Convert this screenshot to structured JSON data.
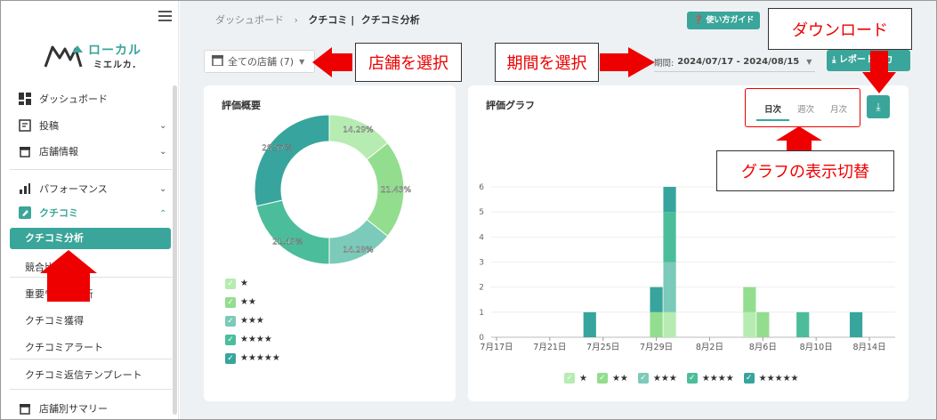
{
  "sidebar": {
    "logo_line1": "ローカル",
    "logo_line2": "ミエルカ.",
    "items": [
      {
        "label": "ダッシュボード"
      },
      {
        "label": "投稿"
      },
      {
        "label": "店舗情報"
      },
      {
        "label": "パフォーマンス"
      },
      {
        "label": "クチコミ"
      }
    ],
    "sub_items": [
      {
        "label": "クチコミ分析"
      },
      {
        "label": "競合比較"
      },
      {
        "label": "重要ワード分析"
      },
      {
        "label": "クチコミ獲得"
      },
      {
        "label": "クチコミアラート"
      },
      {
        "label": "クチコミ返信テンプレート"
      }
    ],
    "bottom_item": "店舗別サマリー"
  },
  "header": {
    "breadcrumb_root": "ダッシュボード",
    "breadcrumb_sep": "›",
    "breadcrumb_parent": "クチコミ |",
    "breadcrumb_current": "クチコミ分析",
    "help_label": "使い方ガイド"
  },
  "filters": {
    "store_value": "全ての店舗 (7)",
    "period_label": "期間:",
    "period_value": "2024/07/17  -  2024/08/15",
    "report_label": "レポート出力"
  },
  "summary_card": {
    "title": "評価概要",
    "legend": [
      "★",
      "★★",
      "★★★",
      "★★★★",
      "★★★★★"
    ]
  },
  "graph_card": {
    "title": "評価グラフ",
    "tabs": [
      "日次",
      "週次",
      "月次"
    ],
    "active_tab": "日次",
    "legend": [
      "★",
      "★★",
      "★★★",
      "★★★★",
      "★★★★★"
    ]
  },
  "colors": {
    "star1": "#b6ecb1",
    "star2": "#93dd8f",
    "star3": "#7ccab9",
    "star4": "#4cbd9a",
    "star5": "#37a59d",
    "accent": "#3aa59a",
    "annotation": "#e00000"
  },
  "annotations": {
    "store": "店舗を選択",
    "period": "期間を選択",
    "download": "ダウンロード",
    "toggle": "グラフの表示切替"
  },
  "chart_data": [
    {
      "type": "pie",
      "title": "評価概要",
      "categories": [
        "★",
        "★★",
        "★★★",
        "★★★★",
        "★★★★★"
      ],
      "values": [
        14.29,
        21.43,
        14.28,
        21.43,
        28.57
      ],
      "labels": [
        "14.29%",
        "21.43%",
        "14.28%",
        "21.43%",
        "28.57%"
      ]
    },
    {
      "type": "bar",
      "title": "評価グラフ",
      "stacked": true,
      "x_tick_labels": [
        "7月17日",
        "7月21日",
        "7月25日",
        "7月29日",
        "8月2日",
        "8月6日",
        "8月10日",
        "8月14日"
      ],
      "ylim": [
        0,
        6
      ],
      "y_ticks": [
        0,
        1,
        2,
        3,
        4,
        5,
        6
      ],
      "bars": [
        {
          "date": "7月24日",
          "stars": [
            0,
            0,
            0,
            0,
            1
          ]
        },
        {
          "date": "7月29日",
          "stars": [
            0,
            1,
            0,
            0,
            1
          ]
        },
        {
          "date": "7月30日",
          "stars": [
            1,
            0,
            2,
            2,
            1
          ]
        },
        {
          "date": "8月5日",
          "stars": [
            1,
            1,
            0,
            0,
            0
          ]
        },
        {
          "date": "8月6日",
          "stars": [
            0,
            1,
            0,
            0,
            0
          ]
        },
        {
          "date": "8月9日",
          "stars": [
            0,
            0,
            0,
            1,
            0
          ]
        },
        {
          "date": "8月13日",
          "stars": [
            0,
            0,
            0,
            0,
            1
          ]
        }
      ]
    }
  ]
}
